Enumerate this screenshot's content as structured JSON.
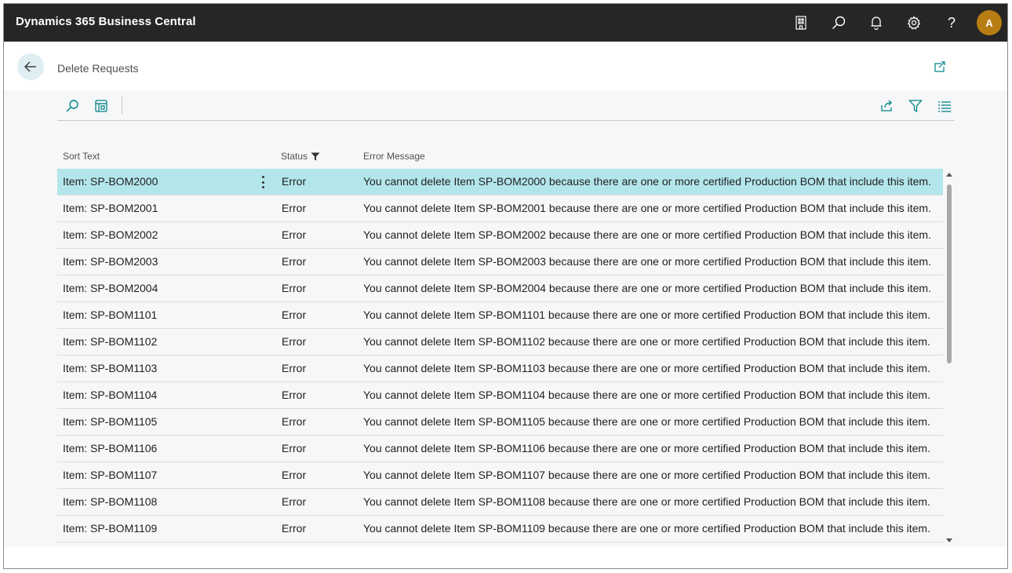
{
  "app": {
    "title": "Dynamics 365 Business Central",
    "user_initial": "A"
  },
  "topbar_icons": [
    "company-icon",
    "search-icon",
    "bell-icon",
    "gear-icon",
    "help-icon"
  ],
  "help_glyph": "?",
  "page": {
    "title": "Delete Requests"
  },
  "columns": {
    "sort_text": "Sort Text",
    "status": "Status",
    "error_message": "Error Message"
  },
  "rows": [
    {
      "sort_text": "Item: SP-BOM2000",
      "status": "Error",
      "error_message": "You cannot delete Item SP-BOM2000 because there are one or more certified Production BOM that include this item.",
      "selected": true
    },
    {
      "sort_text": "Item: SP-BOM2001",
      "status": "Error",
      "error_message": "You cannot delete Item SP-BOM2001 because there are one or more certified Production BOM that include this item."
    },
    {
      "sort_text": "Item: SP-BOM2002",
      "status": "Error",
      "error_message": "You cannot delete Item SP-BOM2002 because there are one or more certified Production BOM that include this item."
    },
    {
      "sort_text": "Item: SP-BOM2003",
      "status": "Error",
      "error_message": "You cannot delete Item SP-BOM2003 because there are one or more certified Production BOM that include this item."
    },
    {
      "sort_text": "Item: SP-BOM2004",
      "status": "Error",
      "error_message": "You cannot delete Item SP-BOM2004 because there are one or more certified Production BOM that include this item."
    },
    {
      "sort_text": "Item: SP-BOM1101",
      "status": "Error",
      "error_message": "You cannot delete Item SP-BOM1101 because there are one or more certified Production BOM that include this item."
    },
    {
      "sort_text": "Item: SP-BOM1102",
      "status": "Error",
      "error_message": "You cannot delete Item SP-BOM1102 because there are one or more certified Production BOM that include this item."
    },
    {
      "sort_text": "Item: SP-BOM1103",
      "status": "Error",
      "error_message": "You cannot delete Item SP-BOM1103 because there are one or more certified Production BOM that include this item."
    },
    {
      "sort_text": "Item: SP-BOM1104",
      "status": "Error",
      "error_message": "You cannot delete Item SP-BOM1104 because there are one or more certified Production BOM that include this item."
    },
    {
      "sort_text": "Item: SP-BOM1105",
      "status": "Error",
      "error_message": "You cannot delete Item SP-BOM1105 because there are one or more certified Production BOM that include this item."
    },
    {
      "sort_text": "Item: SP-BOM1106",
      "status": "Error",
      "error_message": "You cannot delete Item SP-BOM1106 because there are one or more certified Production BOM that include this item."
    },
    {
      "sort_text": "Item: SP-BOM1107",
      "status": "Error",
      "error_message": "You cannot delete Item SP-BOM1107 because there are one or more certified Production BOM that include this item."
    },
    {
      "sort_text": "Item: SP-BOM1108",
      "status": "Error",
      "error_message": "You cannot delete Item SP-BOM1108 because there are one or more certified Production BOM that include this item."
    },
    {
      "sort_text": "Item: SP-BOM1109",
      "status": "Error",
      "error_message": "You cannot delete Item SP-BOM1109 because there are one or more certified Production BOM that include this item."
    }
  ],
  "colors": {
    "topbar": "#262626",
    "accent": "#008489",
    "selected_row": "#b3e6ea",
    "avatar": "#b87d12"
  }
}
